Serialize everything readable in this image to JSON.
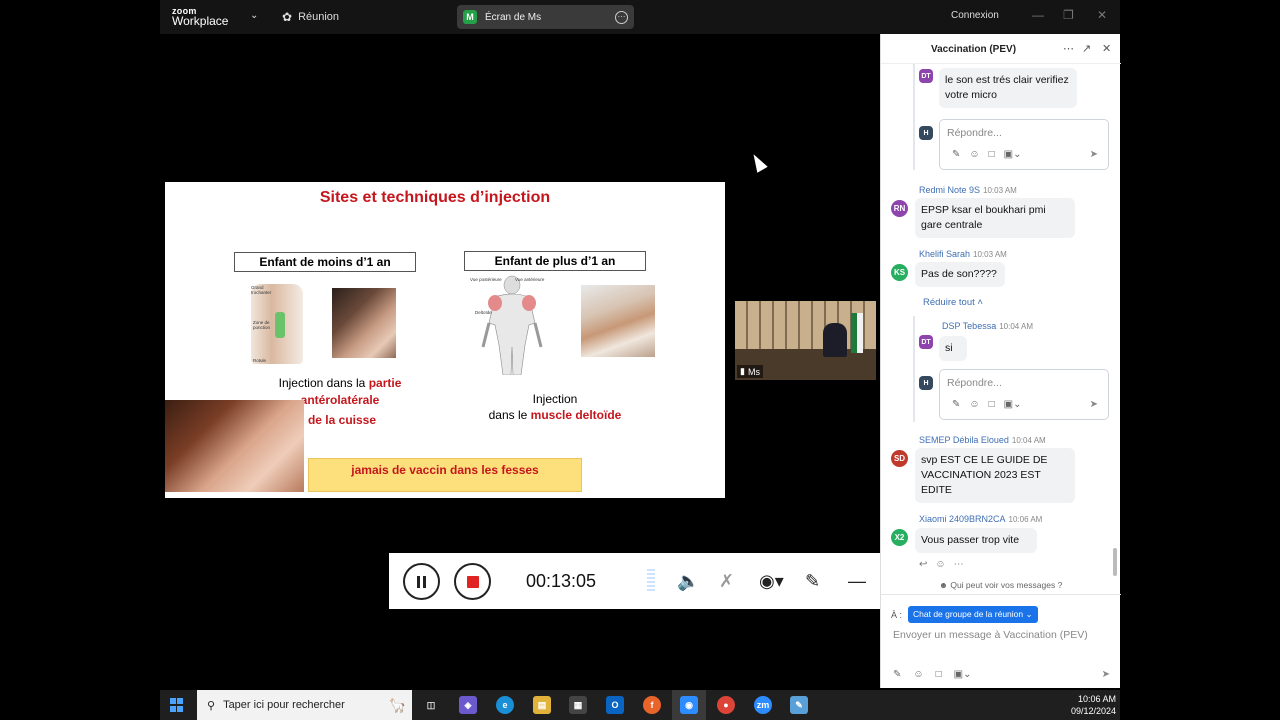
{
  "titlebar": {
    "brand_top": "zoom",
    "brand_bottom": "Workplace",
    "meeting_label": "Réunion",
    "share_label": "Écran de Ms",
    "share_badge": "M",
    "signin_label": "Connexion"
  },
  "slide": {
    "title": "Sites et techniques d’injection",
    "left_box": "Enfant  de moins d’1 an",
    "right_box": "Enfant  de plus d’1 an",
    "left_text_1": "Injection dans la ",
    "left_text_1_red": "partie",
    "left_text_2_red": "antérolatérale",
    "left_text_3_red": "de la cuisse",
    "right_text_1": "Injection",
    "right_text_2": "dans le ",
    "right_text_2_red": "muscle deltoïde",
    "banner": "jamais de vaccin dans les fesses",
    "leg_labels": [
      "Grand trochanter",
      "Zone de ponction",
      "Rotule"
    ],
    "body_labels": [
      "Vue postérieure",
      "Vue antérieure",
      "Deltoïde"
    ]
  },
  "thumbnail": {
    "name": "Ms"
  },
  "recording": {
    "time": "00:13:05"
  },
  "chat": {
    "title": "Vaccination (PEV)",
    "messages": [
      {
        "initials": "DT",
        "text": "le son est trés clair verifiez votre micro"
      },
      {
        "initials": "RN",
        "sender": "Redmi Note 9S",
        "time": "10:03 AM",
        "text": "EPSP ksar el boukhari pmi gare centrale"
      },
      {
        "initials": "KS",
        "sender": "Khelifi Sarah",
        "time": "10:03 AM",
        "text": "Pas de son????"
      },
      {
        "initials": "DT",
        "sender": "DSP Tebessa",
        "time": "10:04 AM",
        "text": "si"
      },
      {
        "initials": "SD",
        "sender": "SEMEP Débila Eloued",
        "time": "10:04 AM",
        "text": "svp EST CE LE GUIDE DE VACCINATION 2023 EST EDITE"
      },
      {
        "initials": "X2",
        "sender": "Xiaomi 2409BRN2CA",
        "time": "10:06 AM",
        "text": "Vous passer trop vite"
      }
    ],
    "reply_placeholder": "Répondre...",
    "reply_initials": "H",
    "reduce_all": "Réduire tout",
    "who_can_see": "Qui peut voir vos messages ?",
    "to_label": "À :",
    "to_value": "Chat de groupe de la réunion",
    "compose_placeholder": "Envoyer un message à Vaccination (PEV)"
  },
  "taskbar": {
    "search_placeholder": "Taper ici pour rechercher",
    "time": "10:06 AM",
    "date": "09/12/2024",
    "zoom_icon_label": "zm"
  },
  "colors": {
    "accent_blue": "#1a73e8",
    "slide_red": "#c4161c",
    "banner_yellow": "#fde07c",
    "chat_sender": "#3f6fb3"
  }
}
